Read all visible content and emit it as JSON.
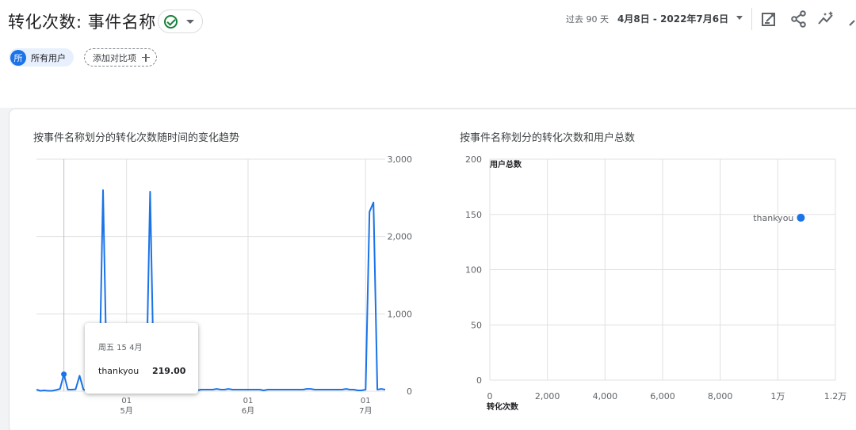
{
  "header": {
    "title": "转化次数: 事件名称",
    "status_icon": "check-circle-icon",
    "date_prefix": "过去 90 天",
    "date_range": "4月8日 - 2022年7月6日",
    "actions": [
      "edit-report-icon",
      "share-icon",
      "insights-icon",
      "overflow-icon"
    ]
  },
  "filters": {
    "segment_avatar": "所",
    "segment_label": "所有用户",
    "compare_label": "添加对比项"
  },
  "colors": {
    "accent": "#1a73e8",
    "series": "#4285f4",
    "grid": "#e0e0e0"
  },
  "line_card": {
    "title": "按事件名称划分的转化次数随时间的变化趋势",
    "tooltip": {
      "date": "周五 15 4月",
      "name": "thankyou",
      "value": "219.00"
    }
  },
  "scatter_card": {
    "title": "按事件名称划分的转化次数和用户总数",
    "point_label": "thankyou"
  },
  "chart_data": [
    {
      "type": "line",
      "series": [
        {
          "name": "thankyou",
          "x": [
            "2022-04-08",
            "2022-04-09",
            "2022-04-10",
            "2022-04-11",
            "2022-04-12",
            "2022-04-13",
            "2022-04-14",
            "2022-04-15",
            "2022-04-16",
            "2022-04-17",
            "2022-04-18",
            "2022-04-19",
            "2022-04-20",
            "2022-04-21",
            "2022-04-22",
            "2022-04-23",
            "2022-04-24",
            "2022-04-25",
            "2022-04-26",
            "2022-04-27",
            "2022-04-28",
            "2022-04-29",
            "2022-04-30",
            "2022-05-01",
            "2022-05-02",
            "2022-05-03",
            "2022-05-04",
            "2022-05-05",
            "2022-05-06",
            "2022-05-07",
            "2022-05-08",
            "2022-05-09",
            "2022-05-10",
            "2022-05-11",
            "2022-05-12",
            "2022-05-13",
            "2022-05-14",
            "2022-05-15",
            "2022-05-16",
            "2022-05-17",
            "2022-05-18",
            "2022-05-19",
            "2022-05-20",
            "2022-05-21",
            "2022-05-22",
            "2022-05-23",
            "2022-05-24",
            "2022-05-25",
            "2022-05-26",
            "2022-05-27",
            "2022-05-28",
            "2022-05-29",
            "2022-05-30",
            "2022-05-31",
            "2022-06-01",
            "2022-06-02",
            "2022-06-03",
            "2022-06-04",
            "2022-06-05",
            "2022-06-06",
            "2022-06-07",
            "2022-06-08",
            "2022-06-09",
            "2022-06-10",
            "2022-06-11",
            "2022-06-12",
            "2022-06-13",
            "2022-06-14",
            "2022-06-15",
            "2022-06-16",
            "2022-06-17",
            "2022-06-18",
            "2022-06-19",
            "2022-06-20",
            "2022-06-21",
            "2022-06-22",
            "2022-06-23",
            "2022-06-24",
            "2022-06-25",
            "2022-06-26",
            "2022-06-27",
            "2022-06-28",
            "2022-06-29",
            "2022-06-30",
            "2022-07-01",
            "2022-07-02",
            "2022-07-03",
            "2022-07-04",
            "2022-07-05",
            "2022-07-06"
          ],
          "values": [
            20,
            5,
            10,
            5,
            5,
            15,
            30,
            219,
            20,
            20,
            25,
            200,
            20,
            10,
            5,
            5,
            5,
            2600,
            20,
            10,
            10,
            10,
            20,
            20,
            20,
            10,
            30,
            10,
            10,
            2580,
            30,
            30,
            20,
            20,
            20,
            20,
            20,
            20,
            20,
            20,
            20,
            10,
            20,
            20,
            20,
            20,
            30,
            20,
            20,
            30,
            20,
            20,
            20,
            20,
            20,
            20,
            20,
            20,
            10,
            20,
            20,
            20,
            20,
            20,
            20,
            20,
            20,
            20,
            20,
            30,
            30,
            20,
            20,
            20,
            20,
            20,
            20,
            20,
            20,
            30,
            20,
            20,
            10,
            10,
            20,
            2320,
            2440,
            20,
            30,
            20
          ]
        }
      ],
      "x_ticks": [
        {
          "date": "2022-05-01",
          "label": [
            "01",
            "5月"
          ]
        },
        {
          "date": "2022-06-01",
          "label": [
            "01",
            "6月"
          ]
        },
        {
          "date": "2022-07-01",
          "label": [
            "01",
            "7月"
          ]
        }
      ],
      "y_ticks": [
        "0",
        "1,000",
        "2,000",
        "3,000"
      ],
      "ylim": [
        0,
        3000
      ],
      "grid": true,
      "highlight": {
        "date": "2022-04-15",
        "value": 219
      }
    },
    {
      "type": "scatter",
      "series": [
        {
          "name": "thankyou",
          "x": [
            10800
          ],
          "y": [
            147
          ]
        }
      ],
      "xlabel": "转化次数",
      "ylabel": "用户总数",
      "x_ticks": [
        "0",
        "2,000",
        "4,000",
        "6,000",
        "8,000",
        "1万",
        "1.2万"
      ],
      "y_ticks": [
        "0",
        "50",
        "100",
        "150",
        "200"
      ],
      "xlim": [
        0,
        12000
      ],
      "ylim": [
        0,
        200
      ],
      "grid": true
    }
  ]
}
